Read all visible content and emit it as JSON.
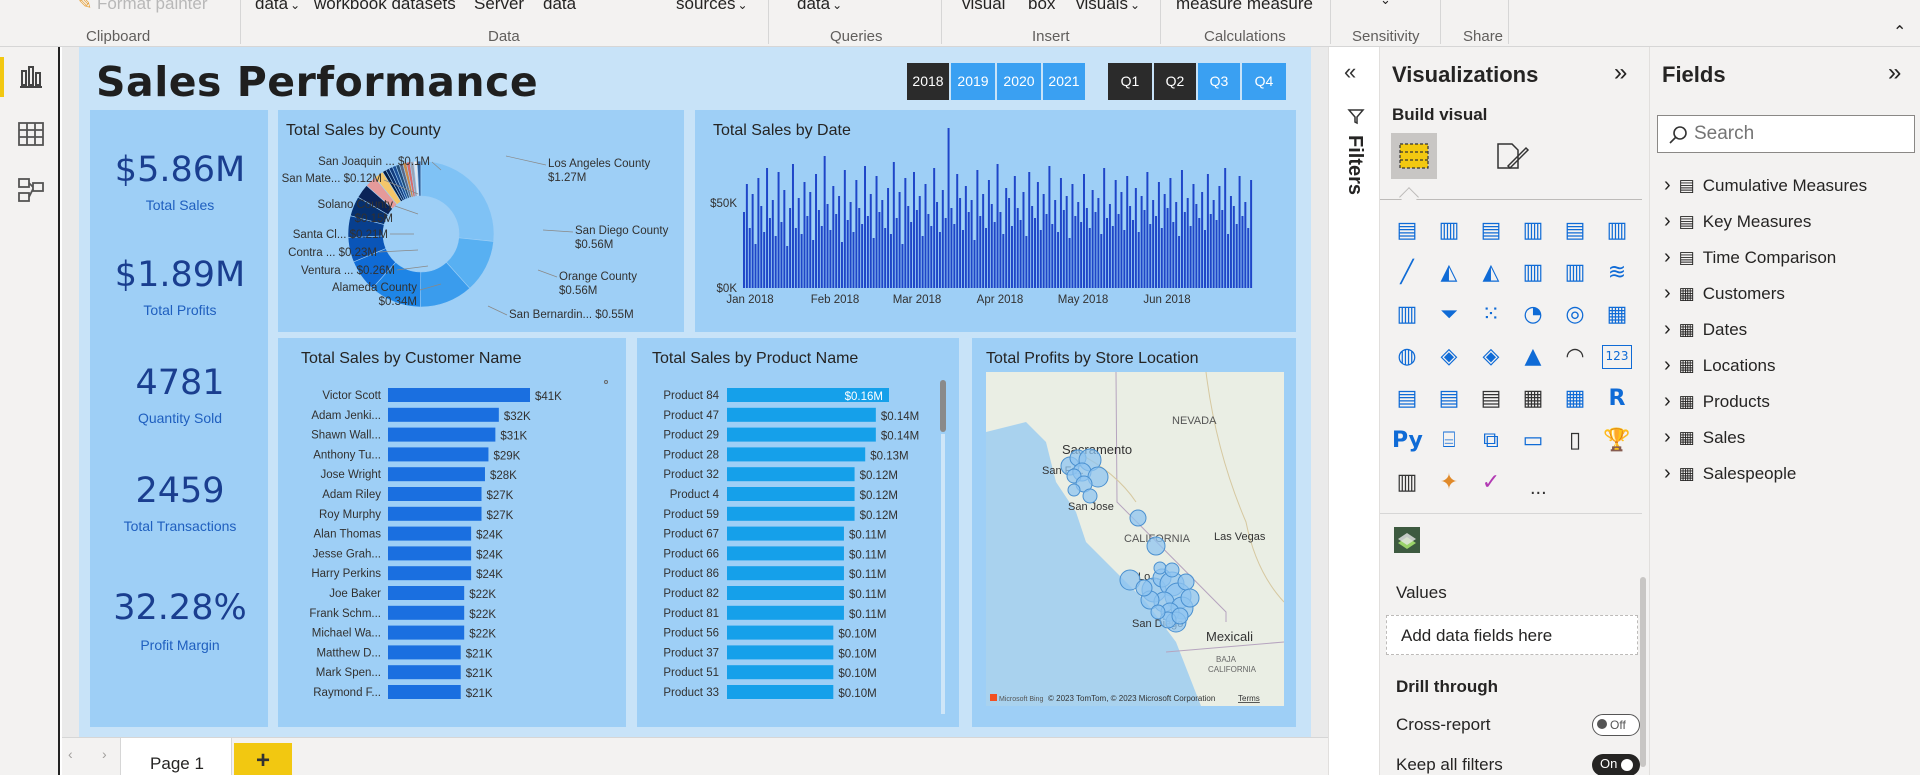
{
  "ribbon": {
    "row_top": {
      "format_painter": "Format painter",
      "data1": "data",
      "workbook": "workbook datasets",
      "server": "Server",
      "data2": "data",
      "sources": "sources",
      "data3": "data",
      "visual": "visual",
      "box": "box",
      "visuals": "visuals",
      "measures": "measure measure"
    },
    "groups": {
      "clipboard": "Clipboard",
      "data": "Data",
      "queries": "Queries",
      "insert": "Insert",
      "calculations": "Calculations",
      "sensitivity": "Sensitivity",
      "share": "Share"
    }
  },
  "report": {
    "title": "Sales Performance",
    "year_slicer": [
      "2018",
      "2019",
      "2020",
      "2021"
    ],
    "quarter_slicer": [
      "Q1",
      "Q2",
      "Q3",
      "Q4"
    ],
    "kpis": [
      {
        "value": "$5.86M",
        "label": "Total Sales"
      },
      {
        "value": "$1.89M",
        "label": "Total Profits"
      },
      {
        "value": "4781",
        "label": "Quantity Sold"
      },
      {
        "value": "2459",
        "label": "Total Transactions"
      },
      {
        "value": "32.28%",
        "label": "Profit Margin"
      }
    ],
    "county": {
      "title": "Total Sales by County",
      "labels": [
        {
          "name": "Los Angeles County",
          "value": "$1.27M"
        },
        {
          "name": "San Diego County",
          "value": "$0.56M"
        },
        {
          "name": "Orange County",
          "value": "$0.56M"
        },
        {
          "name": "San Bernardin...",
          "value": "$0.55M"
        },
        {
          "name": "Alameda County",
          "value": "$0.34M"
        },
        {
          "name": "Ventura ...",
          "value": "$0.26M"
        },
        {
          "name": "Contra ...",
          "value": "$0.23M"
        },
        {
          "name": "Santa Cl...",
          "value": "$0.21M"
        },
        {
          "name": "Solano County",
          "value": "$0.15M"
        },
        {
          "name": "San Mate...",
          "value": "$0.12M"
        },
        {
          "name": "San Joaquin ...",
          "value": "$0.1M"
        }
      ]
    },
    "date": {
      "title": "Total Sales by Date",
      "y_ticks": [
        "$50K",
        "$0K"
      ],
      "x_ticks": [
        "Jan 2018",
        "Feb 2018",
        "Mar 2018",
        "Apr 2018",
        "May 2018",
        "Jun 2018"
      ]
    },
    "customer": {
      "title": "Total Sales by Customer Name"
    },
    "product": {
      "title": "Total Sales by Product Name"
    },
    "map": {
      "title": "Total Profits by Store Location",
      "places": {
        "nevada": "NEVADA",
        "sacramento": "Sacramento",
        "sanfran": "San Fr...",
        "sanjose": "San Jose",
        "california": "CALIFORNIA",
        "lasvegas": "Las Vegas",
        "lo": "Lo...",
        "sandiego": "San Diego",
        "mexicali": "Mexicali",
        "baja": "BAJA",
        "bajacal": "CALIFORNIA"
      },
      "attribution": "© 2023 TomTom, © 2023 Microsoft Corporation",
      "terms": "Terms",
      "bing": "Microsoft Bing"
    }
  },
  "chart_data": [
    {
      "type": "pie",
      "title": "Total Sales by County",
      "categories": [
        "Los Angeles County",
        "San Diego County",
        "Orange County",
        "San Bernardin...",
        "Alameda County",
        "Ventura ...",
        "Contra ...",
        "Santa Cl...",
        "Solano County",
        "San Mate...",
        "San Joaquin ..."
      ],
      "values": [
        1.27,
        0.56,
        0.56,
        0.55,
        0.34,
        0.26,
        0.23,
        0.21,
        0.15,
        0.12,
        0.1
      ],
      "unit": "$M",
      "donut": true
    },
    {
      "type": "bar",
      "title": "Total Sales by Date",
      "x_ticks": [
        "Jan 2018",
        "Feb 2018",
        "Mar 2018",
        "Apr 2018",
        "May 2018",
        "Jun 2018"
      ],
      "ylim": [
        0,
        75000
      ],
      "y_ticks": [
        0,
        50000
      ],
      "note_values": [
        38,
        52,
        30,
        47,
        22,
        55,
        41,
        28,
        60,
        35,
        44,
        26,
        58,
        33,
        49,
        21,
        40,
        62,
        30,
        45,
        27,
        53,
        36,
        48,
        24,
        57,
        39,
        31,
        66,
        42,
        29,
        51,
        37,
        46,
        23,
        59,
        34,
        43,
        28,
        54,
        40,
        32,
        61,
        36,
        47,
        25,
        56,
        38,
        44,
        30,
        50,
        27,
        63,
        35,
        48,
        22,
        55,
        41,
        33,
        58,
        39,
        46,
        26,
        52,
        37,
        31,
        60,
        43,
        28,
        49,
        35,
        80,
        40,
        32,
        57,
        45,
        29,
        51,
        38,
        44,
        24,
        59,
        36,
        47,
        30,
        54,
        42,
        33,
        62,
        38,
        27,
        50,
        45,
        31,
        56,
        40,
        34,
        48,
        26,
        58,
        41,
        35,
        53,
        29,
        47,
        37,
        61,
        32,
        44,
        28,
        55,
        39,
        46,
        25,
        52,
        36,
        43,
        33,
        57,
        40,
        30,
        49,
        38,
        45,
        27,
        60,
        35,
        42,
        31,
        54,
        37,
        48,
        29,
        56,
        41,
        34,
        50,
        28,
        46,
        39,
        58,
        32,
        44,
        36,
        53,
        30,
        47,
        40,
        55,
        33,
        43,
        26,
        59,
        38,
        45,
        31,
        52,
        42,
        35,
        48,
        29,
        57,
        37,
        44,
        34,
        51,
        39,
        60,
        27,
        46,
        41,
        32,
        56,
        36,
        43,
        30,
        54
      ]
    },
    {
      "type": "bar",
      "title": "Total Sales by Customer Name",
      "categories": [
        "Victor Scott",
        "Adam Jenki...",
        "Shawn Wall...",
        "Anthony Tu...",
        "Jose Wright",
        "Adam Riley",
        "Roy Murphy",
        "Alan Thomas",
        "Jesse Grah...",
        "Harry Perkins",
        "Joe Baker",
        "Frank Schm...",
        "Michael Wa...",
        "Matthew D...",
        "Mark Spen...",
        "Raymond F..."
      ],
      "values": [
        41,
        32,
        31,
        29,
        28,
        27,
        27,
        24,
        24,
        24,
        22,
        22,
        22,
        21,
        21,
        21
      ],
      "labels": [
        "$41K",
        "$32K",
        "$31K",
        "$29K",
        "$28K",
        "$27K",
        "$27K",
        "$24K",
        "$24K",
        "$24K",
        "$22K",
        "$22K",
        "$22K",
        "$21K",
        "$21K",
        "$21K"
      ],
      "orientation": "horizontal"
    },
    {
      "type": "bar",
      "title": "Total Sales by Product Name",
      "categories": [
        "Product 84",
        "Product 47",
        "Product 29",
        "Product 28",
        "Product 32",
        "Product 4",
        "Product 59",
        "Product 67",
        "Product 66",
        "Product 86",
        "Product 82",
        "Product 81",
        "Product 56",
        "Product 37",
        "Product 51",
        "Product 33"
      ],
      "values": [
        0.16,
        0.14,
        0.14,
        0.13,
        0.12,
        0.12,
        0.12,
        0.11,
        0.11,
        0.11,
        0.11,
        0.11,
        0.1,
        0.1,
        0.1,
        0.1
      ],
      "labels": [
        "$0.16M",
        "$0.14M",
        "$0.14M",
        "$0.13M",
        "$0.12M",
        "$0.12M",
        "$0.12M",
        "$0.11M",
        "$0.11M",
        "$0.11M",
        "$0.11M",
        "$0.11M",
        "$0.10M",
        "$0.10M",
        "$0.10M",
        "$0.10M"
      ],
      "orientation": "horizontal"
    }
  ],
  "filters": {
    "label": "Filters"
  },
  "visualizations": {
    "title": "Visualizations",
    "build_visual": "Build visual",
    "values_label": "Values",
    "add_fields": "Add data fields here",
    "drill_through": "Drill through",
    "cross_report": "Cross-report",
    "cross_report_state": "Off",
    "keep_filters": "Keep all filters",
    "keep_filters_state": "On",
    "more": "..."
  },
  "fields": {
    "title": "Fields",
    "search_placeholder": "Search",
    "tables": [
      "Cumulative Measures",
      "Key Measures",
      "Time Comparison",
      "Customers",
      "Dates",
      "Locations",
      "Products",
      "Sales",
      "Salespeople"
    ]
  },
  "pages": {
    "tabs": [
      "Page 1"
    ],
    "add": "+"
  },
  "colors": {
    "accent": "#f2c811",
    "report_bg": "#c8e3f8",
    "panel": "#9ecff6",
    "bar_dark": "#1a6fe0",
    "bar_light": "#15a0ea",
    "kpi": "#1a3e8f"
  }
}
